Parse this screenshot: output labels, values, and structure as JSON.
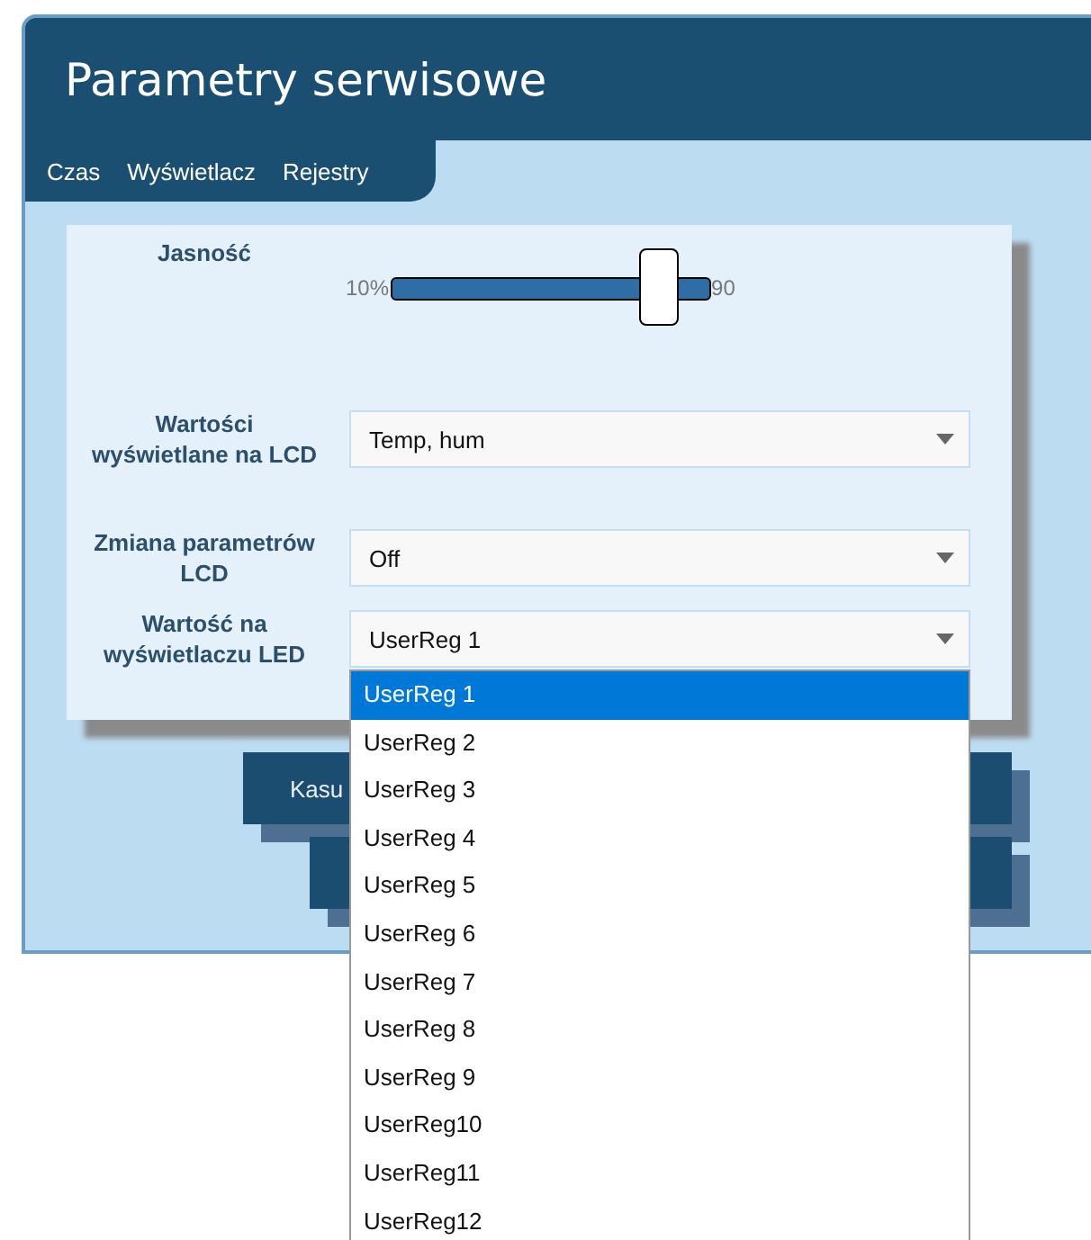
{
  "window": {
    "title": "Parametry serwisowe"
  },
  "tabs": [
    {
      "label": "Czas",
      "selected": false
    },
    {
      "label": "Wyświetlacz",
      "selected": false
    },
    {
      "label": "Rejestry",
      "selected": false
    }
  ],
  "brightness": {
    "label": "Jasność",
    "min_label": "10%",
    "max_label": "90",
    "level": 0.84
  },
  "fields": [
    {
      "label": "Wartości wyświetlane na LCD",
      "value": "Temp, hum"
    },
    {
      "label": "Zmiana parametrów LCD",
      "value": "Off"
    },
    {
      "label": "Wartość na wyświetlaczu LED",
      "value": "UserReg 1",
      "options": [
        {
          "label": "UserReg 1",
          "selected": true
        },
        {
          "label": "UserReg 2",
          "selected": false
        },
        {
          "label": "UserReg 3",
          "selected": false
        },
        {
          "label": "UserReg 4",
          "selected": false
        },
        {
          "label": "UserReg 5",
          "selected": false
        },
        {
          "label": "UserReg 6",
          "selected": false
        },
        {
          "label": "UserReg 7",
          "selected": false
        },
        {
          "label": "UserReg 8",
          "selected": false
        },
        {
          "label": "UserReg 9",
          "selected": false
        },
        {
          "label": "UserReg10",
          "selected": false
        },
        {
          "label": "UserReg11",
          "selected": false
        },
        {
          "label": "UserReg12",
          "selected": false
        }
      ]
    }
  ],
  "buttons": [
    {
      "kind": "labeled",
      "label": "Kasu"
    },
    {
      "kind": "covered"
    }
  ]
}
